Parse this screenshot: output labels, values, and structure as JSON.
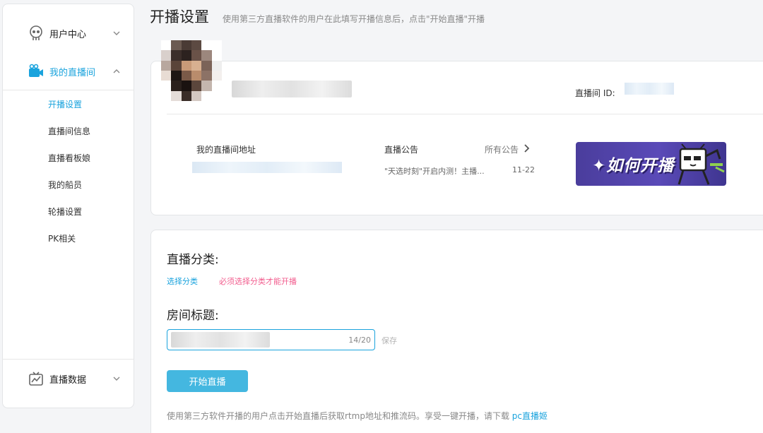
{
  "sidebar": {
    "user_center": "用户中心",
    "my_room": "我的直播间",
    "items": [
      {
        "label": "开播设置",
        "active": true
      },
      {
        "label": "直播间信息",
        "active": false
      },
      {
        "label": "直播看板娘",
        "active": false
      },
      {
        "label": "我的船员",
        "active": false
      },
      {
        "label": "轮播设置",
        "active": false
      },
      {
        "label": "PK相关",
        "active": false
      }
    ],
    "live_data": "直播数据"
  },
  "header": {
    "title": "开播设置",
    "subtitle": "使用第三方直播软件的用户在此填写开播信息后，点击\"开始直播\"开播"
  },
  "info": {
    "room_id_label": "直播间 ID:",
    "address_label": "我的直播间地址",
    "notice_label": "直播公告",
    "all_notices": "所有公告",
    "notice_text": "\"天选时刻\"开启内测！主播...",
    "notice_date": "11-22",
    "banner_text": "✦如何开播"
  },
  "form": {
    "category_title": "直播分类:",
    "select_category": "选择分类",
    "category_required": "必须选择分类才能开播",
    "room_title_label": "房间标题:",
    "title_counter": "14/20",
    "save": "保存",
    "start_button": "开始直播",
    "bottom_note": "使用第三方软件开播的用户点击开始直播后获取rtmp地址和推流码。享受一键开播，请下载 ",
    "bottom_link": "pc直播姬"
  },
  "colors": {
    "accent": "#1aa3dd",
    "button": "#44b7e0",
    "warning": "#f25d8e",
    "banner": "#5a4ab8"
  }
}
